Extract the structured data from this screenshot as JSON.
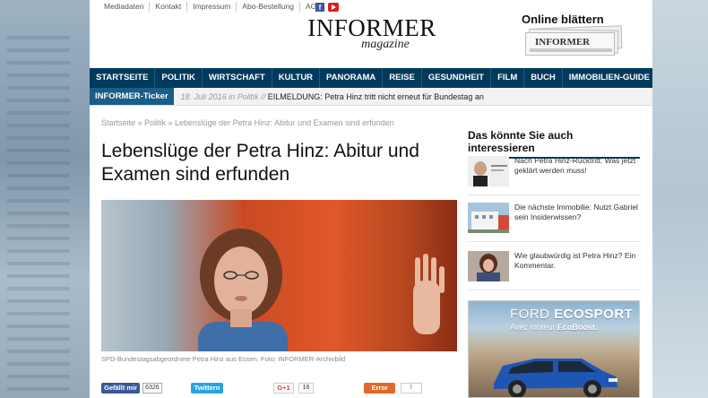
{
  "topnav": {
    "items": [
      "Mediadaten",
      "Kontakt",
      "Impressum",
      "Abo-Bestellung",
      "AGB"
    ]
  },
  "social": {
    "facebook_glyph": "f"
  },
  "logo": {
    "main": "INFORMER",
    "sub": "magazine"
  },
  "online": {
    "label": "Online blättern",
    "magazine_title": "INFORMER"
  },
  "mainnav": {
    "items": [
      "STARTSEITE",
      "POLITIK",
      "WIRTSCHAFT",
      "KULTUR",
      "PANORAMA",
      "REISE",
      "GESUNDHEIT",
      "FILM",
      "BUCH",
      "IMMOBILIEN-GUIDE"
    ]
  },
  "ticker": {
    "label": "INFORMER-Ticker",
    "meta": "18. Juli 2016 in Politik //",
    "text": " EILMELDUNG: Petra Hinz tritt nicht erneut für Bundestag an"
  },
  "breadcrumb": "Startseite » Politik » Lebenslüge der Petra Hinz: Abitur und Examen sind erfunden",
  "article": {
    "headline": "Lebenslüge der Petra Hinz: Abitur und Examen sind erfunden",
    "caption": "SPD-Bundestagsabgeordnete Petra Hinz aus Essen. Foto: INFORMER-Archivbild"
  },
  "share": {
    "facebook_label": "Gefällt mir",
    "facebook_count": "6326",
    "twitter_label": "Twittern",
    "gplus_label": "G+1",
    "gplus_count": "16",
    "error_label": "Error",
    "error_count": "!"
  },
  "sidebar": {
    "title": "Das könnte Sie auch interessieren",
    "items": [
      {
        "text": "Nach Petra Hinz-Rücktritt: Was jetzt geklärt werden muss!"
      },
      {
        "text": "Die nächste Immobilie: Nutzt Gabriel sein Insiderwissen?"
      },
      {
        "text": "Wie glaubwürdig ist Petra Hinz? Ein Kommentar."
      }
    ]
  },
  "ad": {
    "brand_light": "FORD ",
    "brand_bold": "ECOSPORT",
    "sub_light": "Avec moteur ",
    "sub_bold": "EcoBoost."
  },
  "colors": {
    "nav_bg": "#003a5c",
    "ticker_label_bg": "#1a5d86",
    "facebook": "#3b5998",
    "twitter": "#2ba3e2",
    "error": "#e0692a"
  },
  "icons": {
    "facebook": "facebook-icon",
    "youtube": "youtube-icon"
  }
}
